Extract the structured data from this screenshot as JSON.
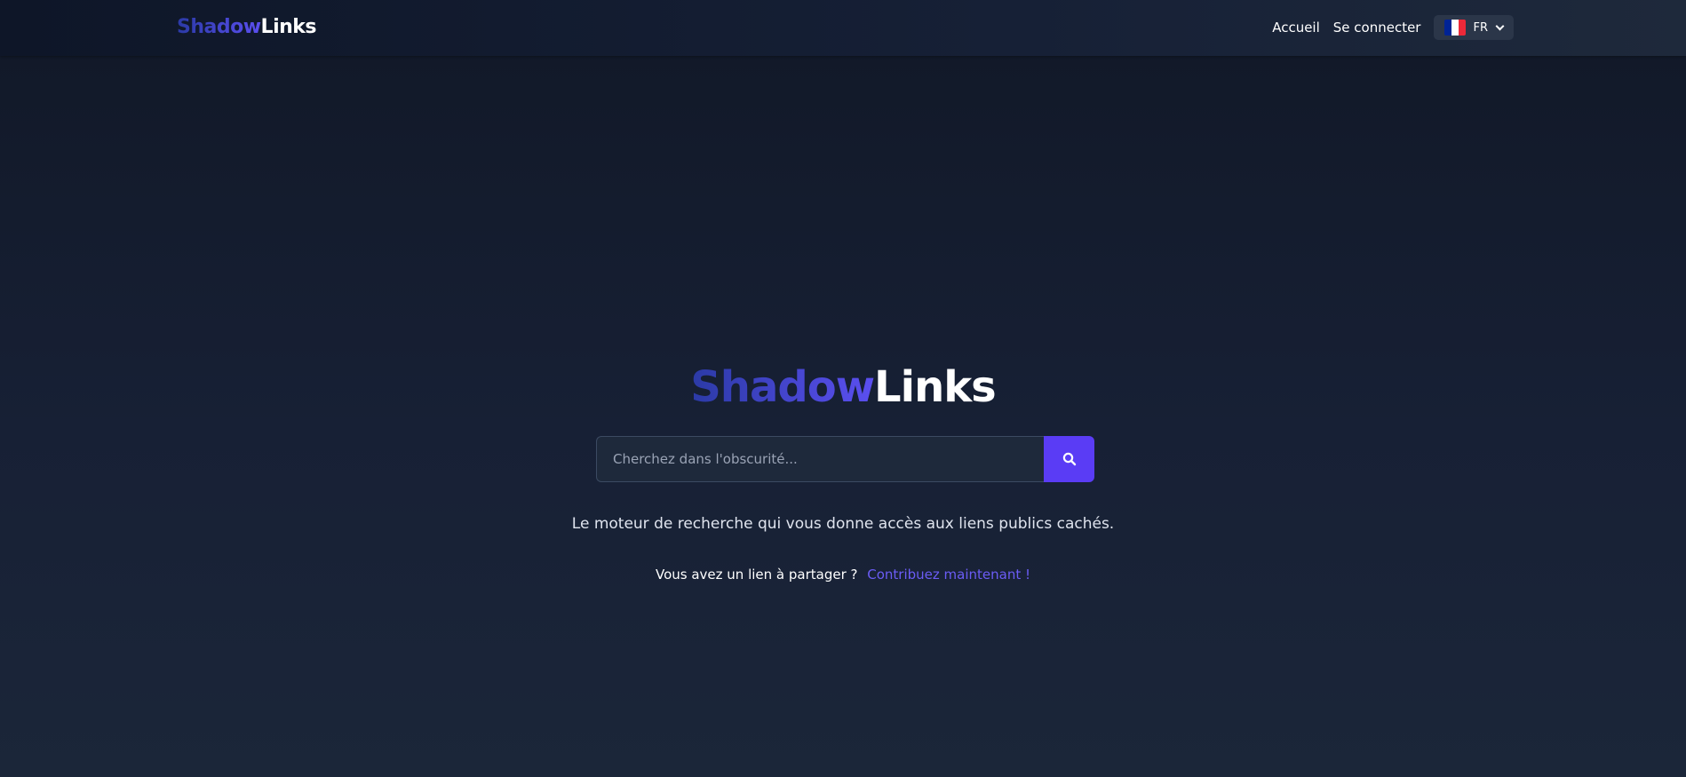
{
  "header": {
    "brand": {
      "part1": "Shadow",
      "part2": "Links"
    },
    "nav": {
      "home_label": "Accueil",
      "login_label": "Se connecter"
    },
    "language": {
      "selected": "FR",
      "flag_icon": "france-flag-icon",
      "flag_colors": [
        "#002395",
        "#ffffff",
        "#ed2939"
      ]
    }
  },
  "hero": {
    "title": {
      "part1": "Shadow",
      "part2": "Links"
    },
    "search": {
      "placeholder": "Cherchez dans l'obscurité...",
      "value": "",
      "button_icon": "search-icon"
    },
    "tagline": "Le moteur de recherche qui vous donne accès aux liens publics cachés.",
    "contribute": {
      "prompt": "Vous avez un lien à partager ?",
      "link_label": "Contribuez maintenant !"
    }
  },
  "colors": {
    "accent": "#5a3cf5",
    "brand_gradient_start": "#2b3aa6",
    "brand_gradient_end": "#5b4ff0",
    "link": "#6b5cf6"
  }
}
